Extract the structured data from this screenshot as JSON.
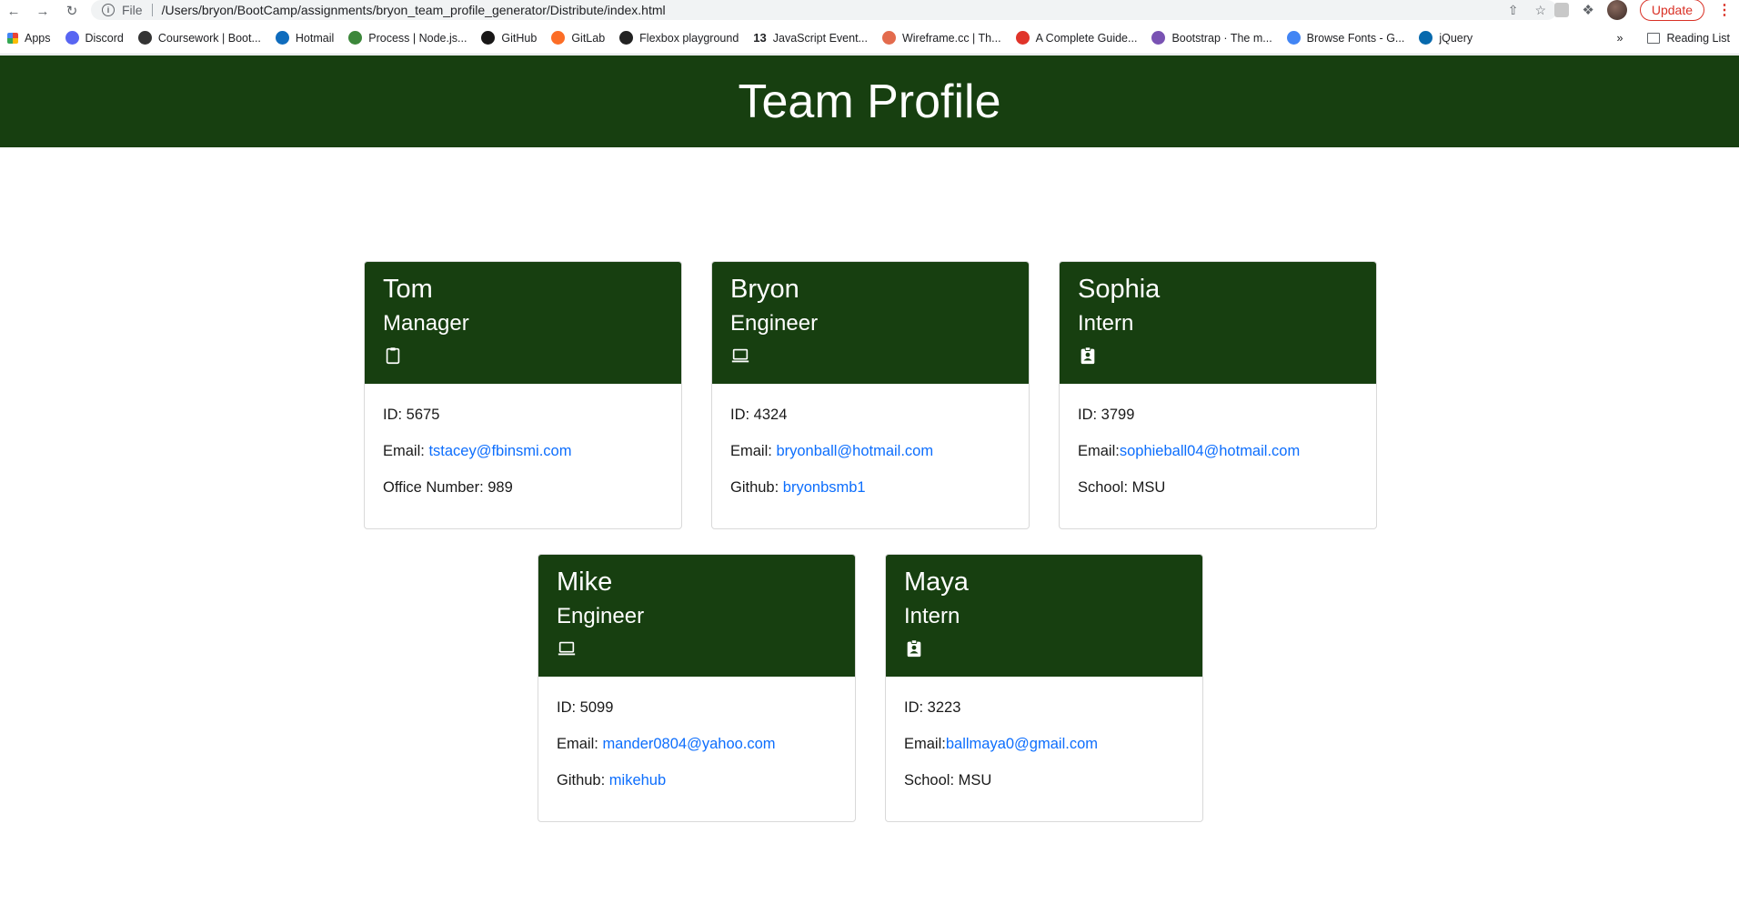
{
  "browser": {
    "address_scheme": "File",
    "url": "/Users/bryon/BootCamp/assignments/bryon_team_profile_generator/Distribute/index.html",
    "update_label": "Update",
    "bookmarks": [
      {
        "label": "Apps",
        "icon": "apps-grid-icon",
        "color": "#e8453c"
      },
      {
        "label": "Discord",
        "icon": "discord-icon",
        "color": "#5865f2"
      },
      {
        "label": "Coursework | Boot...",
        "icon": "globe-icon",
        "color": "#333333"
      },
      {
        "label": "Hotmail",
        "icon": "outlook-icon",
        "color": "#0f6cbd"
      },
      {
        "label": "Process | Node.js...",
        "icon": "nodejs-icon",
        "color": "#3c873a"
      },
      {
        "label": "GitHub",
        "icon": "github-icon",
        "color": "#181717"
      },
      {
        "label": "GitLab",
        "icon": "gitlab-icon",
        "color": "#fc6d26"
      },
      {
        "label": "Flexbox playground",
        "icon": "codepen-icon",
        "color": "#222222"
      },
      {
        "label": "JavaScript Event...",
        "icon": "thirteen-icon",
        "color": "#ffffff"
      },
      {
        "label": "Wireframe.cc | Th...",
        "icon": "wireframe-icon",
        "color": "#e36b4d"
      },
      {
        "label": "A Complete Guide...",
        "icon": "css-tricks-icon",
        "color": "#e0342a"
      },
      {
        "label": "Bootstrap · The m...",
        "icon": "bootstrap-icon",
        "color": "#7952b3"
      },
      {
        "label": "Browse Fonts - G...",
        "icon": "google-fonts-icon",
        "color": "#4285f4"
      },
      {
        "label": "jQuery",
        "icon": "jquery-icon",
        "color": "#0769ad"
      }
    ],
    "bookmark_prefix_13": "13",
    "more_label": "»",
    "reading_list_label": "Reading List"
  },
  "page": {
    "title": "Team Profile",
    "colors": {
      "header_bg": "#173f10",
      "link": "#0d6efd"
    }
  },
  "cards": [
    {
      "name": "Tom",
      "role": "Manager",
      "icon": "clipboard-icon",
      "id_label": "ID: 5675",
      "email_label": "Email: ",
      "email": "tstacey@fbinsmi.com",
      "extra_label": "Office Number: 989",
      "extra_link": ""
    },
    {
      "name": "Bryon",
      "role": "Engineer",
      "icon": "laptop-icon",
      "id_label": "ID: 4324",
      "email_label": "Email: ",
      "email": "bryonball@hotmail.com",
      "extra_label": "Github: ",
      "extra_link": "bryonbsmb1"
    },
    {
      "name": "Sophia",
      "role": "Intern",
      "icon": "id-badge-icon",
      "id_label": "ID: 3799",
      "email_label": "Email:",
      "email": "sophieball04@hotmail.com",
      "extra_label": "School: MSU",
      "extra_link": ""
    },
    {
      "name": "Mike",
      "role": "Engineer",
      "icon": "laptop-icon",
      "id_label": "ID: 5099",
      "email_label": "Email: ",
      "email": "mander0804@yahoo.com",
      "extra_label": "Github: ",
      "extra_link": "mikehub"
    },
    {
      "name": "Maya",
      "role": "Intern",
      "icon": "id-badge-icon",
      "id_label": "ID: 3223",
      "email_label": "Email:",
      "email": "ballmaya0@gmail.com",
      "extra_label": "School: MSU",
      "extra_link": ""
    }
  ]
}
